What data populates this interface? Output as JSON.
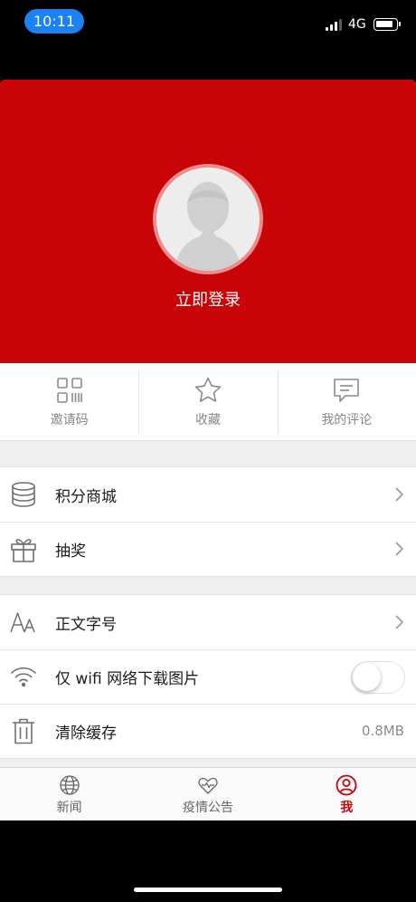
{
  "status_bar": {
    "time": "10:11",
    "network": "4G",
    "icons": [
      "signal-icon",
      "battery-icon"
    ],
    "time_pill_color": "#1a82f5"
  },
  "theme": {
    "brand_red": "#c80407",
    "background": "#efefef"
  },
  "header": {
    "avatar_icon": "default-avatar-icon",
    "login_label": "立即登录"
  },
  "quick_actions": [
    {
      "label": "邀请码",
      "icon": "qr-code-icon"
    },
    {
      "label": "收藏",
      "icon": "star-icon"
    },
    {
      "label": "我的评论",
      "icon": "comment-icon"
    }
  ],
  "menu_group_1": [
    {
      "label": "积分商城",
      "icon": "database-icon"
    },
    {
      "label": "抽奖",
      "icon": "gift-icon"
    }
  ],
  "menu_group_2": [
    {
      "label": "正文字号",
      "icon": "font-size-icon"
    },
    {
      "label": "仅 wifi 网络下载图片",
      "icon": "wifi-icon",
      "toggle_on": false
    },
    {
      "label": "清除缓存",
      "icon": "trash-icon",
      "value": "0.8MB"
    }
  ],
  "tabbar": {
    "active": "我",
    "tabs": [
      {
        "label": "新闻",
        "icon": "globe-icon"
      },
      {
        "label": "疫情公告",
        "icon": "heart-icon"
      },
      {
        "label": "我",
        "icon": "user-icon"
      }
    ]
  }
}
